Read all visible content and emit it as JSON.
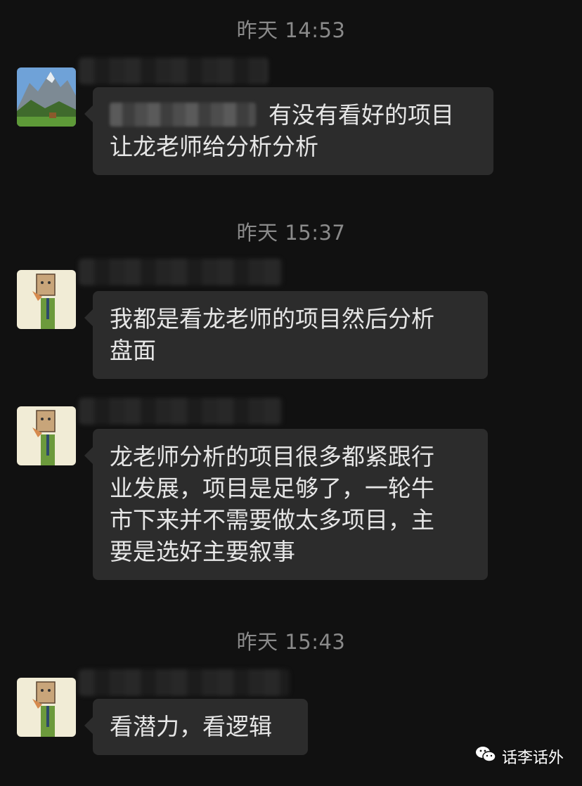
{
  "messages": [
    {
      "time": "昨天 14:53",
      "avatar": "mountain-landscape-avatar",
      "text": "有没有看好的项目\n让龙老师给分析分析"
    },
    {
      "time": "昨天 15:37",
      "avatar": "fox-paperbag-avatar",
      "text": "我都是看龙老师的项目然后分析\n盘面"
    },
    {
      "avatar": "fox-paperbag-avatar",
      "text": "龙老师分析的项目很多都紧跟行\n业发展，项目是足够了，一轮牛\n市下来并不需要做太多项目，主\n要是选好主要叙事"
    },
    {
      "time": "昨天 15:43",
      "avatar": "fox-paperbag-avatar",
      "text": "看潜力，看逻辑"
    }
  ],
  "watermark": {
    "icon": "wechat-icon",
    "label": "话李话外"
  },
  "colors": {
    "background": "#111111",
    "bubble": "#2c2c2c",
    "text": "#e6e6e6",
    "timestamp": "#8a8a8a"
  }
}
